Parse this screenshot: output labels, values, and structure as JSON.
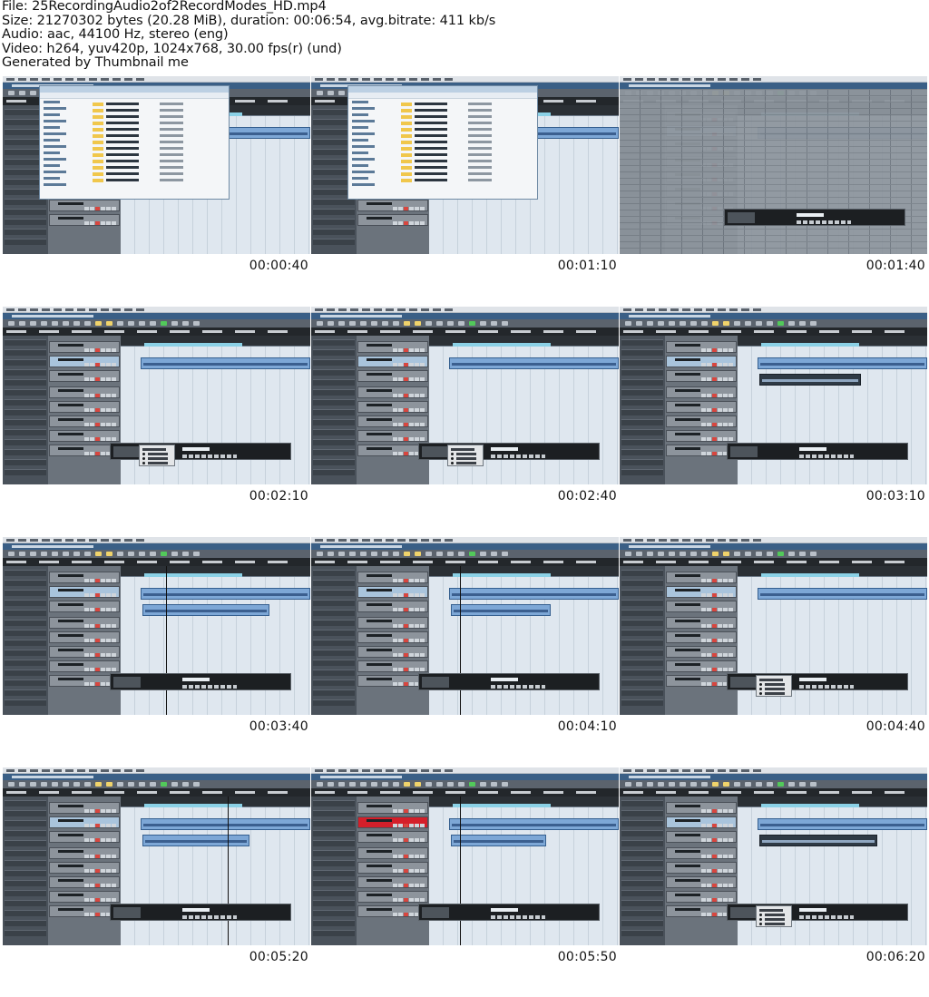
{
  "header": {
    "lines": [
      "File: 25RecordingAudio2of2RecordModes_HD.mp4",
      "Size: 21270302 bytes (20.28 MiB), duration: 00:06:54, avg.bitrate: 411 kb/s",
      "Audio: aac, 44100 Hz, stereo (eng)",
      "Video: h264, yuv420p, 1024x768, 30.00 fps(r) (und)",
      "Generated by Thumbnail me"
    ]
  },
  "thumbnails": [
    {
      "timestamp": "00:00:40",
      "scene": "explorer"
    },
    {
      "timestamp": "00:01:10",
      "scene": "explorer"
    },
    {
      "timestamp": "00:01:40",
      "scene": "mixer"
    },
    {
      "timestamp": "00:02:10",
      "scene": "menu"
    },
    {
      "timestamp": "00:02:40",
      "scene": "menu"
    },
    {
      "timestamp": "00:03:10",
      "scene": "record"
    },
    {
      "timestamp": "00:03:40",
      "scene": "record"
    },
    {
      "timestamp": "00:04:10",
      "scene": "record"
    },
    {
      "timestamp": "00:04:40",
      "scene": "menu"
    },
    {
      "timestamp": "00:05:20",
      "scene": "record"
    },
    {
      "timestamp": "00:05:50",
      "scene": "record-armed"
    },
    {
      "timestamp": "00:06:20",
      "scene": "menu"
    }
  ],
  "colors": {
    "event_blue": "#7da7d6",
    "loop_cyan": "#8bd1e6",
    "record_red": "#d41f2a"
  }
}
